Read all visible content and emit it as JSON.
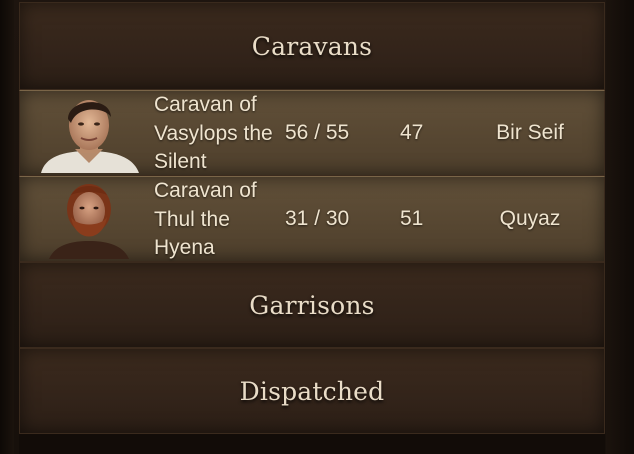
{
  "sections": {
    "caravans_label": "Caravans",
    "garrisons_label": "Garrisons",
    "dispatched_label": "Dispatched"
  },
  "caravans": [
    {
      "name": "Caravan of Vasylops the Silent",
      "troops": "56 / 55",
      "speed": "47",
      "location": "Bir Seif",
      "portrait_icon": "young-man-portrait"
    },
    {
      "name": "Caravan of Thul the Hyena",
      "troops": "31 / 30",
      "speed": "51",
      "location": "Quyaz",
      "portrait_icon": "red-bearded-man-portrait"
    }
  ],
  "colors": {
    "header_bg": "#35261b",
    "row_bg": "#5a4934",
    "text": "#efe4cf",
    "title_text": "#e9dcc7"
  }
}
